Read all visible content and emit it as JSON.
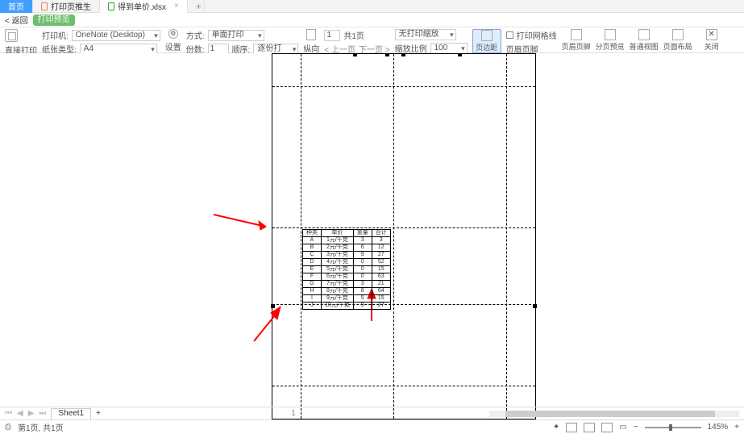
{
  "tabs": {
    "home": "首页",
    "doc1": "打印页推生",
    "doc2": "得到单价.xlsx"
  },
  "backrow": {
    "back": "< 返回",
    "preview": "打印预览"
  },
  "toolbar": {
    "direct_print": "直接打印",
    "printer_label": "打印机:",
    "printer_value": "OneNote (Desktop)",
    "paper_label": "纸张类型:",
    "paper_value": "A4",
    "settings": "设置",
    "orient_label": "方式:",
    "orient_value": "单面打印",
    "copies_label": "份数:",
    "copies_value": "1",
    "order_label": "顺序:",
    "order_value": "逐份打印",
    "orient_btn": "纵向",
    "page_from": "1",
    "page_total": "共1页",
    "prev": "上一页",
    "next": "下一页",
    "scaling_value": "无打印缩放",
    "ratio_label": "缩放比例",
    "ratio_value": "100 %",
    "margins": "页边距",
    "grid_chk": "打印网格线",
    "header_footer": "页眉页脚",
    "header_both": "页眉页脚",
    "page_break": "分页预览",
    "normal": "普通视图",
    "page_layout": "页面布局",
    "close": "关闭"
  },
  "table": {
    "headers": [
      "种类",
      "单价",
      "重量",
      "合计"
    ],
    "rows": [
      [
        "A",
        "1元/千克",
        "3",
        "3"
      ],
      [
        "B",
        "2元/千克",
        "6",
        "12"
      ],
      [
        "C",
        "3元/千克",
        "9",
        "27"
      ],
      [
        "D",
        "4元/千克",
        "0",
        "52"
      ],
      [
        "E",
        "5元/千克",
        "0",
        "15"
      ],
      [
        "F",
        "6元/千克",
        "0",
        "63"
      ],
      [
        "G",
        "7元/千克",
        "3",
        "21"
      ],
      [
        "H",
        "8元/千克",
        "8",
        "64"
      ],
      [
        "I",
        "9元/千克",
        "5",
        "15"
      ],
      [
        "J",
        "10元/千克",
        "9",
        "27"
      ]
    ]
  },
  "sheet": {
    "name": "Sheet1",
    "plus": "+",
    "page_indicator": "1"
  },
  "status": {
    "icon": "⎙",
    "pages": "第1页, 共1页",
    "zoom": "145%",
    "plus": "+"
  }
}
